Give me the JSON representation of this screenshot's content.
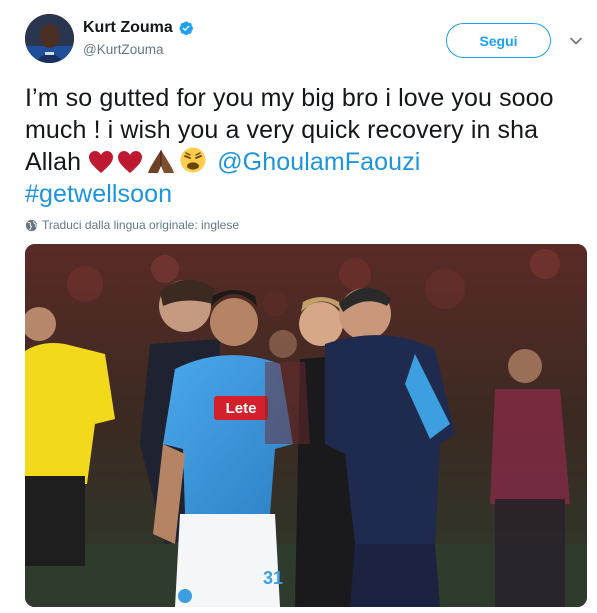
{
  "user": {
    "display_name": "Kurt Zouma",
    "handle": "@KurtZouma",
    "verified": true
  },
  "actions": {
    "follow_label": "Segui"
  },
  "tweet": {
    "text_main": "I’m so gutted for you my big bro i love you sooo much ! i wish you a very quick recovery in sha Allah ",
    "mention": "@GhoulamFaouzi",
    "hashtag": "#getwellsoon",
    "emojis": [
      "red-heart",
      "red-heart",
      "folded-hands",
      "weary-face"
    ]
  },
  "translate": {
    "label": "Traduci dalla lingua originale: inglese"
  },
  "media": {
    "shirt_sponsor": "Lete",
    "shirt_number": "31"
  },
  "colors": {
    "brand_blue": "#1da1f2",
    "link_blue": "#1b95e0",
    "secondary_text": "#657786",
    "napoli_blue": "#3d9ee0"
  }
}
